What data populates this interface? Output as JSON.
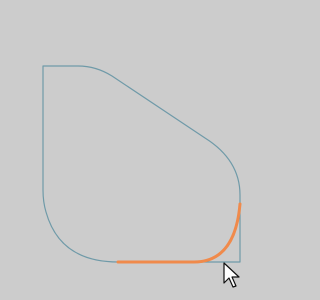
{
  "app": {
    "title": ""
  },
  "canvas": {
    "background_color": "#cccccc",
    "shape": {
      "name": "rounded-shape-outline",
      "stroke_color": "#6f9aa8"
    },
    "highlight": {
      "name": "selected-corner-segment",
      "stroke_color": "#f08a4b"
    },
    "cursor": {
      "icon": "arrow-pointer-icon"
    }
  }
}
